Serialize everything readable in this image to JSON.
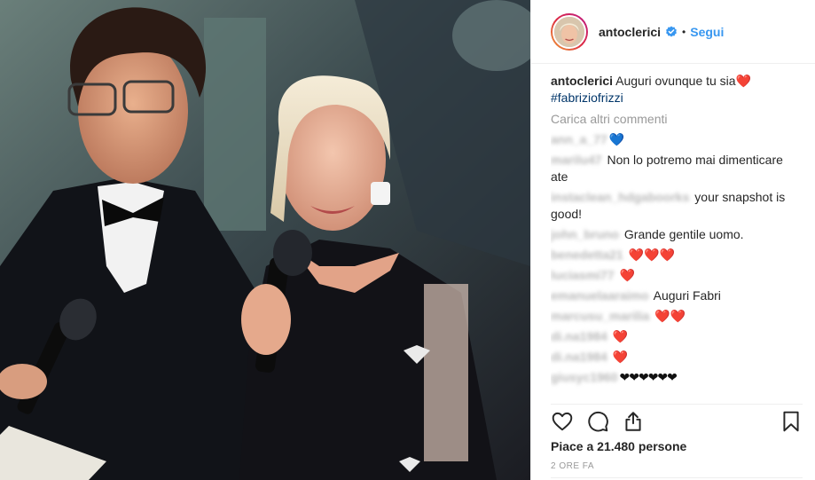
{
  "header": {
    "username": "antoclerici",
    "separator": "•",
    "follow_label": "Segui"
  },
  "caption": {
    "username": "antoclerici",
    "text": " Auguri ovunque tu sia",
    "heart": "❤️",
    "hashtag": "#fabriziofrizzi"
  },
  "load_more_label": "Carica altri commenti",
  "comments": [
    {
      "user": "ann_a_77",
      "text": "",
      "emoji": "💙",
      "emoji_kind": "blue"
    },
    {
      "user": "marilu47",
      "text": " Non lo potremo mai dimenticare ate",
      "emoji": "",
      "emoji_kind": ""
    },
    {
      "user": "instaclean_hdgaboorks",
      "text": " your snapshot is good!",
      "emoji": "",
      "emoji_kind": ""
    },
    {
      "user": "john_bruno",
      "text": " Grande gentile uomo.",
      "emoji": "",
      "emoji_kind": ""
    },
    {
      "user": "benedetta21",
      "text": " ",
      "emoji": "❤️❤️❤️",
      "emoji_kind": "red"
    },
    {
      "user": "luciasmi77",
      "text": " ",
      "emoji": "❤️",
      "emoji_kind": "red"
    },
    {
      "user": "emanuelaaraimo",
      "text": " Auguri Fabri",
      "emoji": "",
      "emoji_kind": ""
    },
    {
      "user": "marcusu_marilia",
      "text": " ",
      "emoji": "❤️❤️",
      "emoji_kind": "red"
    },
    {
      "user": "di.na1984",
      "text": " ",
      "emoji": "❤️",
      "emoji_kind": "red"
    },
    {
      "user": "di.na1984",
      "text": " ",
      "emoji": "❤️",
      "emoji_kind": "red"
    },
    {
      "user": "giusyc1960",
      "text": "",
      "emoji": "❤❤❤❤❤❤",
      "emoji_kind": "black"
    }
  ],
  "actions": {
    "like_icon": "heart-outline-icon",
    "comment_icon": "comment-bubble-icon",
    "share_icon": "share-upload-icon",
    "save_icon": "bookmark-icon"
  },
  "likes_text": "Piace a 21.480 persone",
  "time_text": "2 ORE FA",
  "colors": {
    "link_blue": "#3897f0",
    "heart_red": "#e8203b",
    "muted": "#999999",
    "text": "#262626"
  }
}
